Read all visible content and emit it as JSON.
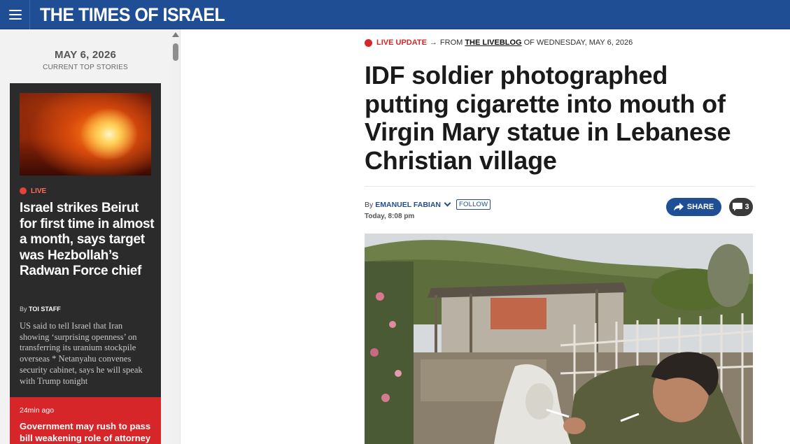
{
  "header": {
    "logo_text": "THE TIMES OF ISRAEL",
    "menu_icon": "hamburger-menu-icon",
    "brand_color": "#1f4e95"
  },
  "sidebar": {
    "date": "MAY 6, 2026",
    "subtitle": "CURRENT TOP STORIES",
    "lead_story": {
      "live_label": "LIVE",
      "headline": "Israel strikes Beirut for first time in almost a month, says target was Hezbollah’s Radwan Force chief",
      "byline_prefix": "By",
      "byline_author": "TOI STAFF",
      "summary": "US said to tell Israel that Iran showing ‘surprising openness’ on transferring its uranium stockpile overseas * Netanyahu convenes security cabinet, says he will speak with Trump tonight"
    },
    "update_story": {
      "time": "24min ago",
      "headline": "Government may rush to pass bill weakening role of attorney"
    }
  },
  "article": {
    "kicker": {
      "live_label": "LIVE UPDATE",
      "arrow": "→",
      "from_text": "FROM",
      "liveblog_link": "THE LIVEBLOG",
      "of_text": "OF WEDNESDAY, MAY 6, 2026"
    },
    "headline": "IDF soldier photographed putting cigarette into mouth of Virgin Mary statue in Lebanese Christian village",
    "byline": {
      "prefix": "By",
      "author": "EMANUEL FABIAN",
      "follow_label": "FOLLOW"
    },
    "timestamp": "Today, 8:08 pm",
    "share_label": "SHARE",
    "comment_count": "3",
    "accent_color": "#d7262a"
  }
}
